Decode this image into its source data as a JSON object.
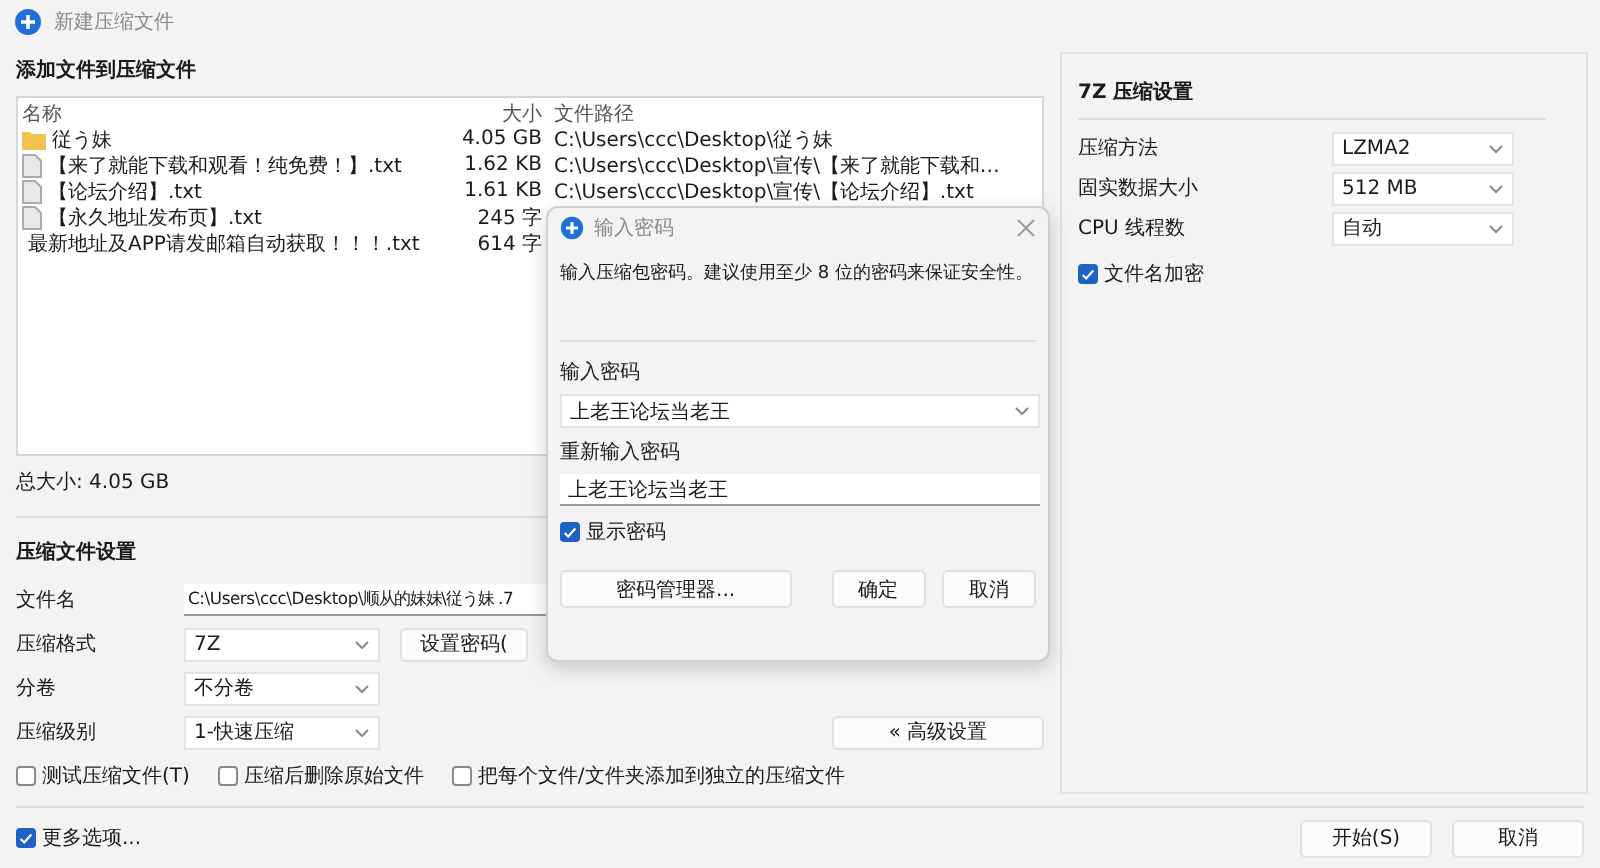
{
  "window": {
    "title": "新建压缩文件"
  },
  "files": {
    "heading": "添加文件到压缩文件",
    "columns": [
      "名称",
      "大小",
      "文件路径"
    ],
    "rows": [
      {
        "kind": "folder",
        "name": "従う妹",
        "size": "4.05 GB",
        "path": "C:\\Users\\ccc\\Desktop\\従う妹"
      },
      {
        "kind": "file",
        "name": "【来了就能下载和观看！纯免费！】.txt",
        "size": "1.62 KB",
        "path": "C:\\Users\\ccc\\Desktop\\宣传\\【来了就能下载和…"
      },
      {
        "kind": "file",
        "name": "【论坛介绍】.txt",
        "size": "1.61 KB",
        "path": "C:\\Users\\ccc\\Desktop\\宣传\\【论坛介绍】.txt"
      },
      {
        "kind": "file",
        "name": "【永久地址发布页】.txt",
        "size": "245 字"
      },
      {
        "kind": "file",
        "name": "最新地址及APP请发邮箱自动获取！！！.txt",
        "size": "614 字"
      }
    ],
    "total": "总大小: 4.05 GB"
  },
  "settings": {
    "heading": "压缩文件设置",
    "filename": {
      "label": "文件名",
      "value": "C:\\Users\\ccc\\Desktop\\顺从的妹妹\\従う妹 .7"
    },
    "format": {
      "label": "压缩格式",
      "value": "7Z"
    },
    "password_button": "设置密码(",
    "volume": {
      "label": "分卷",
      "value": "不分卷"
    },
    "level": {
      "label": "压缩级别",
      "value": "1-快速压缩"
    },
    "advanced_button": "« 高级设置",
    "options": [
      {
        "label": "测试压缩文件(T)",
        "checked": false
      },
      {
        "label": "压缩后删除原始文件",
        "checked": false
      },
      {
        "label": "把每个文件/文件夹添加到独立的压缩文件",
        "checked": false
      }
    ]
  },
  "format_settings": {
    "heading": "7Z 压缩设置",
    "rows": [
      {
        "label": "压缩方法",
        "value": "LZMA2"
      },
      {
        "label": "固实数据大小",
        "value": "512 MB"
      },
      {
        "label": "CPU 线程数",
        "value": "自动"
      }
    ],
    "encrypt_names": {
      "label": "文件名加密",
      "checked": true
    }
  },
  "more_options": {
    "label": "更多选项...",
    "checked": true
  },
  "buttons": [
    "开始(S)",
    "取消"
  ],
  "dialog": {
    "title": "输入密码",
    "message": "输入压缩包密码。建议使用至少 8 位的密码来保证安全性。",
    "password": {
      "label": "输入密码",
      "value": "上老王论坛当老王"
    },
    "confirm": {
      "label": "重新输入密码",
      "value": "上老王论坛当老王"
    },
    "show_password": {
      "label": "显示密码",
      "checked": true
    },
    "buttons": [
      "密码管理器...",
      "确定",
      "取消"
    ]
  }
}
